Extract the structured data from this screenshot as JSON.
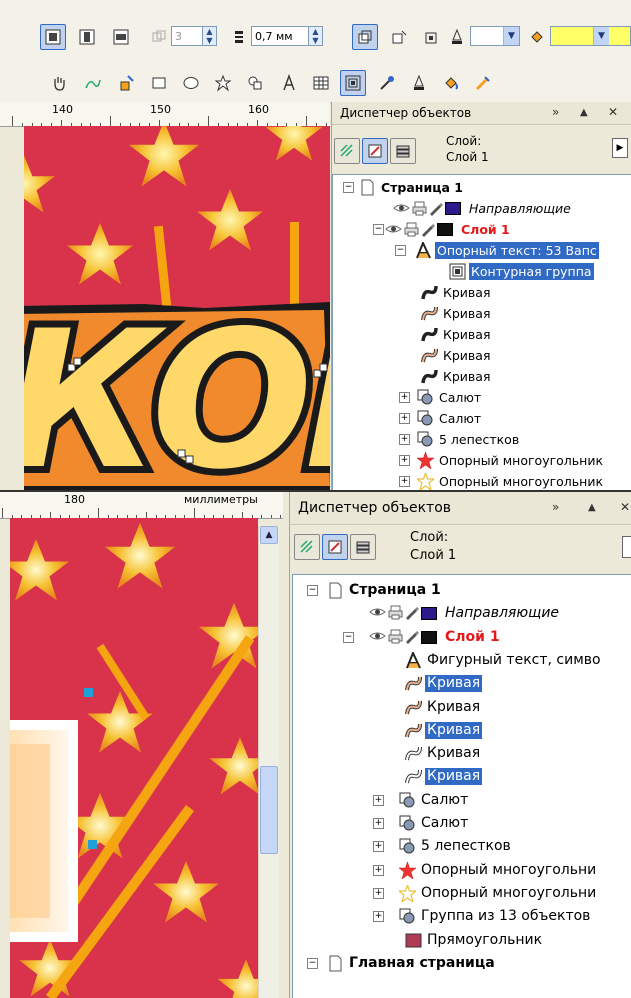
{
  "top_panel": {
    "toolbar": {
      "copies_value": "3",
      "outline_width_value": "0,7 мм"
    },
    "ruler_labels": [
      "140",
      "150",
      "160"
    ],
    "artwork_text": "КОП",
    "docker": {
      "title": "Диспетчер объектов",
      "layer_label": "Слой:",
      "layer_value": "Слой 1",
      "tree": [
        {
          "label": "Страница 1",
          "icon": "page-icon",
          "expander": "⊟"
        },
        {
          "label": "Направляющие",
          "icon": "layer-guides-icon",
          "swatch": "#2a1a8a"
        },
        {
          "label": "Слой 1",
          "icon": "layer-icon",
          "swatch": "#111111",
          "expander": "⊟"
        },
        {
          "label": "Опорный текст: 53 Вапс",
          "icon": "artistic-text-icon",
          "expander": "⊟",
          "selected": true
        },
        {
          "label": "Контурная группа",
          "icon": "contour-group-icon",
          "selected": true
        },
        {
          "label": "Кривая",
          "icon": "curve-dark-icon"
        },
        {
          "label": "Кривая",
          "icon": "curve-light-icon"
        },
        {
          "label": "Кривая",
          "icon": "curve-dark-icon"
        },
        {
          "label": "Кривая",
          "icon": "curve-light-icon"
        },
        {
          "label": "Кривая",
          "icon": "curve-dark-icon"
        },
        {
          "label": "Салют",
          "icon": "group-icon",
          "expander": "⊞"
        },
        {
          "label": "Салют",
          "icon": "group-icon",
          "expander": "⊞"
        },
        {
          "label": "5 лепестков",
          "icon": "group-icon",
          "expander": "⊞"
        },
        {
          "label": "Опорный многоугольник",
          "icon": "star-red-icon",
          "expander": "⊞"
        },
        {
          "label": "Опорный многоугольник",
          "icon": "star-outline-icon",
          "expander": "⊞"
        }
      ]
    },
    "colors": {
      "canvas_bg": "#d8334a",
      "star_fill": "#f7c234",
      "selection_bg": "#316ac5"
    }
  },
  "bottom_panel": {
    "ruler_labels": [
      "180"
    ],
    "ruler_units": "миллиметры",
    "docker": {
      "title": "Диспетчер объектов",
      "layer_label": "Слой:",
      "layer_value": "Слой 1",
      "tree": [
        {
          "label": "Страница 1",
          "icon": "page-icon",
          "expander": "⊟"
        },
        {
          "label": "Направляющие",
          "icon": "layer-guides-icon",
          "swatch": "#2a1a8a"
        },
        {
          "label": "Слой 1",
          "icon": "layer-icon",
          "swatch": "#111111",
          "expander": "⊟"
        },
        {
          "label": "Фигурный текст, симво",
          "icon": "artistic-text-icon"
        },
        {
          "label": "Кривая",
          "icon": "curve-light-icon",
          "selected": true
        },
        {
          "label": "Кривая",
          "icon": "curve-light-icon"
        },
        {
          "label": "Кривая",
          "icon": "curve-light-icon",
          "selected": true
        },
        {
          "label": "Кривая",
          "icon": "curve-white-icon"
        },
        {
          "label": "Кривая",
          "icon": "curve-white-icon",
          "selected": true
        },
        {
          "label": "Салют",
          "icon": "group-icon",
          "expander": "⊞"
        },
        {
          "label": "Салют",
          "icon": "group-icon",
          "expander": "⊞"
        },
        {
          "label": "5 лепестков",
          "icon": "group-icon",
          "expander": "⊞"
        },
        {
          "label": "Опорный многоугольни",
          "icon": "star-red-icon",
          "expander": "⊞"
        },
        {
          "label": "Опорный многоугольни",
          "icon": "star-outline-icon",
          "expander": "⊞"
        },
        {
          "label": "Группа из 13 объектов",
          "icon": "group-icon",
          "expander": "⊞"
        },
        {
          "label": "Прямоугольник",
          "icon": "rectangle-icon"
        },
        {
          "label": "Главная страница",
          "icon": "page-icon",
          "expander": "⊟"
        }
      ]
    }
  }
}
